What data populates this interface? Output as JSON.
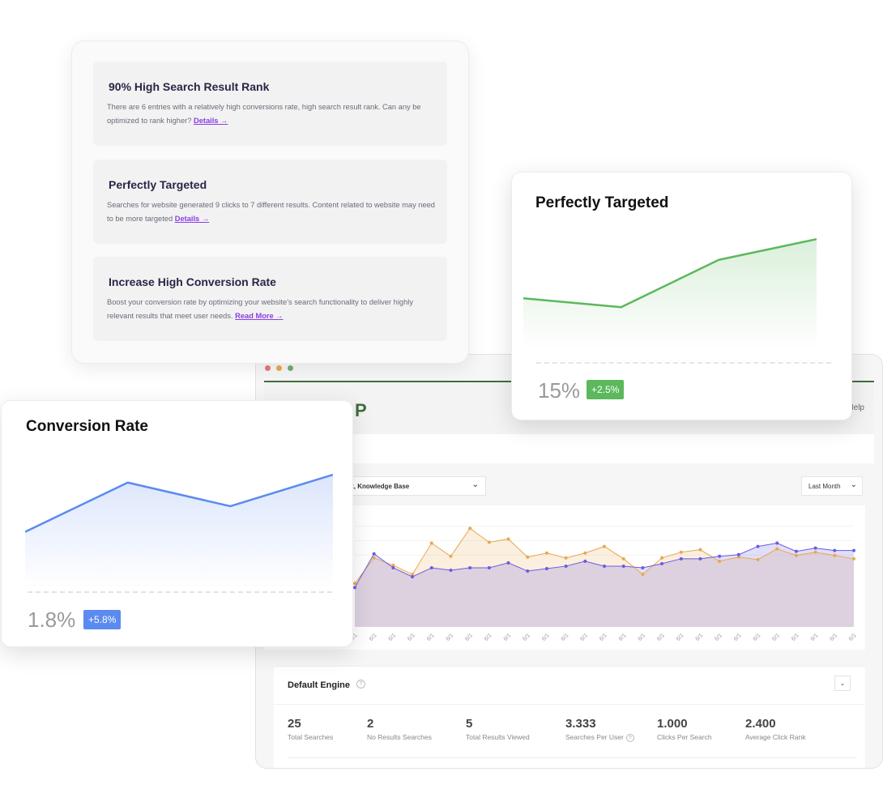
{
  "insights": [
    {
      "title": "90% High Search Result Rank",
      "text": "There are 6 entries with a relatively high conversions rate, high search result rank. Can any be optimized to rank higher? ",
      "link": "Details →"
    },
    {
      "title": "Perfectly Targeted",
      "text": "Searches for website generated 9 clicks to 7 different results. Content related to website may need to be more targeted ",
      "link": "Details →"
    },
    {
      "title": "Increase High Conversion Rate",
      "text": "Boost your conversion rate by optimizing your website's search functionality to deliver highly relevant results that meet user needs. ",
      "link": "Read More →"
    }
  ],
  "perfectly_targeted_card": {
    "title": "Perfectly Targeted",
    "value": "15%",
    "change": "+2.5%",
    "color": "#5cb85c"
  },
  "conversion_rate_card": {
    "title": "Conversion Rate",
    "value": "1.8%",
    "change": "+5.8%",
    "color": "#5b8af0"
  },
  "dashboard": {
    "window_dots": [
      "#e8787a",
      "#e8a84f",
      "#6fae6f"
    ],
    "logo_partial": "P",
    "help_label": "Help",
    "engine_filter": "ult, Knowledge Base",
    "period_filter": "Last Month",
    "chevron": "⌄",
    "engine": {
      "title": "Default Engine",
      "toggle": "⌄",
      "help": "?",
      "stats": [
        {
          "value": "25",
          "label": "Total Searches",
          "help": false
        },
        {
          "value": "2",
          "label": "No Results Searches",
          "help": false
        },
        {
          "value": "5",
          "label": "Total Results Viewed",
          "help": false
        },
        {
          "value": "3.333",
          "label": "Searches Per User",
          "help": true
        },
        {
          "value": "1.000",
          "label": "Clicks Per Search",
          "help": false
        },
        {
          "value": "2.400",
          "label": "Average Click Rank",
          "help": false
        }
      ]
    }
  },
  "chart_data": [
    {
      "type": "area",
      "title": "Perfectly Targeted",
      "x": [
        1,
        2,
        3,
        4
      ],
      "values": [
        30,
        24,
        56,
        70
      ],
      "ylim": [
        0,
        80
      ],
      "color": "#5cb85c"
    },
    {
      "type": "area",
      "title": "Conversion Rate",
      "x": [
        1,
        2,
        3,
        4
      ],
      "values": [
        48,
        98,
        74,
        106
      ],
      "ylim": [
        0,
        120
      ],
      "color": "#5b8af0"
    },
    {
      "type": "area",
      "title": "",
      "tick_label": "6/1",
      "categories": [
        "6/1",
        "6/1",
        "6/1",
        "6/1",
        "6/1",
        "6/1",
        "6/1",
        "6/1",
        "6/1",
        "6/1",
        "6/1",
        "6/1",
        "6/1",
        "6/1",
        "6/1",
        "6/1",
        "6/1",
        "6/1",
        "6/1",
        "6/1",
        "6/1",
        "6/1",
        "6/1",
        "6/1",
        "6/1",
        "6/1",
        "6/1"
      ],
      "series": [
        {
          "name": "series-orange",
          "color": "#e8a84f",
          "values": [
            53,
            84,
            75,
            64,
            102,
            86,
            120,
            103,
            107,
            85,
            90,
            84,
            90,
            98,
            83,
            64,
            84,
            91,
            94,
            80,
            85,
            82,
            95,
            87,
            91,
            87,
            83
          ]
        },
        {
          "name": "series-purple",
          "color": "#6a5be0",
          "values": [
            48,
            89,
            72,
            61,
            72,
            69,
            72,
            72,
            78,
            68,
            71,
            74,
            80,
            74,
            74,
            72,
            77,
            83,
            83,
            86,
            88,
            98,
            102,
            92,
            96,
            93,
            93
          ]
        }
      ],
      "ylim": [
        0,
        140
      ],
      "grid": true
    }
  ]
}
